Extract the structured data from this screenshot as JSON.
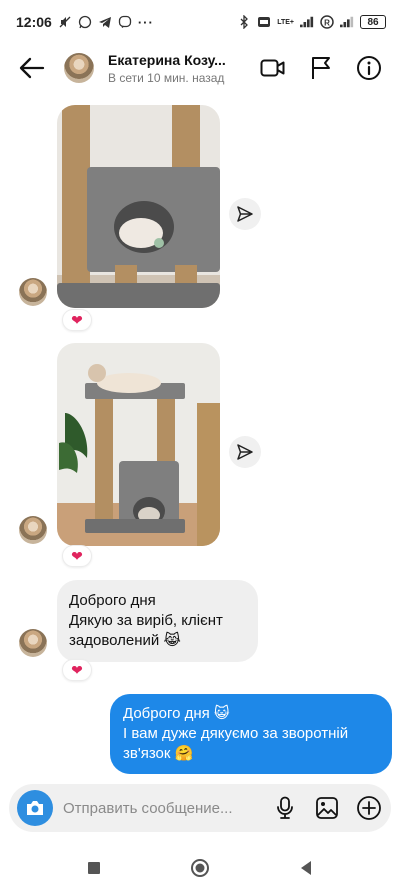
{
  "status_bar": {
    "time": "12:06",
    "more_label": "···",
    "lte_label": "LTE+",
    "battery": "86"
  },
  "header": {
    "contact_name": "Екатерина Козу...",
    "contact_status": "В сети 10 мин. назад"
  },
  "messages": [
    {
      "type": "photo",
      "reaction": "❤"
    },
    {
      "type": "photo",
      "reaction": "❤"
    },
    {
      "type": "text_in",
      "lines": [
        "Доброго дня",
        "Дякую за виріб, клієнт",
        "задоволений 😹"
      ],
      "reaction": "❤"
    },
    {
      "type": "text_out",
      "lines": [
        "Доброго дня 😺",
        "І вам дуже дякуємо за зворотній",
        "зв'язок 🤗"
      ]
    }
  ],
  "composer": {
    "placeholder": "Отправить сообщение..."
  },
  "colors": {
    "accent": "#1e88e8",
    "incoming_bubble": "#efefef",
    "heart": "#e0245e"
  },
  "icons": [
    "back-arrow-icon",
    "video-call-icon",
    "flag-icon",
    "info-icon",
    "share-icon",
    "camera-icon",
    "microphone-icon",
    "gallery-icon",
    "plus-circle-icon"
  ]
}
